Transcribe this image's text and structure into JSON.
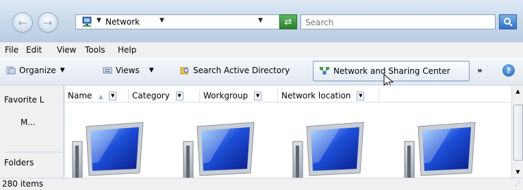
{
  "address": {
    "location": "Network",
    "search_placeholder": "Search"
  },
  "menu": [
    "File",
    "Edit",
    "View",
    "Tools",
    "Help"
  ],
  "toolbar": {
    "organize": "Organize",
    "views": "Views",
    "search_ad": "Search Active Directory",
    "network_center": "Network and Sharing Center",
    "overflow": "»"
  },
  "nav": {
    "favorites": "Favorite L",
    "more": "M...",
    "folders": "Folders"
  },
  "columns": [
    "Name",
    "Category",
    "Workgroup",
    "Network location"
  ],
  "items_icon": "network-computer-icon",
  "status": {
    "count": "280 items"
  },
  "colors": {
    "accent": "#2f6fc4",
    "refresh": "#2a7d2a"
  }
}
